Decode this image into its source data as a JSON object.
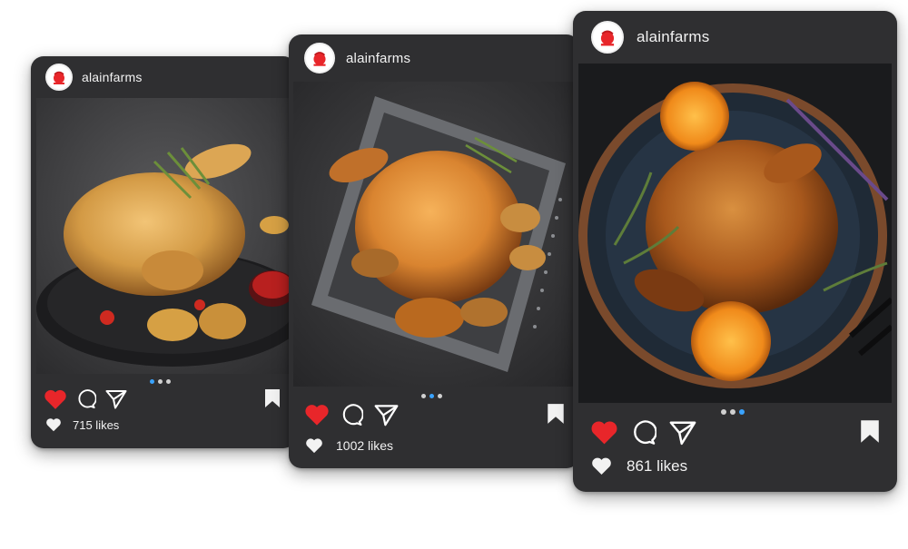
{
  "brand": {
    "avatar_colors": {
      "ring": "#e8262a",
      "fill": "#ffffff"
    },
    "like_color": "#e8262a",
    "dot_active_color": "#3aa3ff"
  },
  "posts": [
    {
      "username": "alainfarms",
      "likes_text": "715 likes",
      "liked": true,
      "dots": 3,
      "active_dot": 1,
      "photo_desc_icon": "roast-chicken-on-plate-icon"
    },
    {
      "username": "alainfarms",
      "likes_text": "1002 likes",
      "liked": true,
      "dots": 3,
      "active_dot": 2,
      "photo_desc_icon": "roast-chicken-in-tray-icon"
    },
    {
      "username": "alainfarms",
      "likes_text": "861 likes",
      "liked": true,
      "dots": 3,
      "active_dot": 3,
      "photo_desc_icon": "roast-chicken-with-oranges-icon"
    }
  ],
  "icons": {
    "like": "heart-icon",
    "comment": "comment-icon",
    "share": "send-icon",
    "save": "bookmark-icon",
    "likes_small": "heart-outline-icon"
  }
}
